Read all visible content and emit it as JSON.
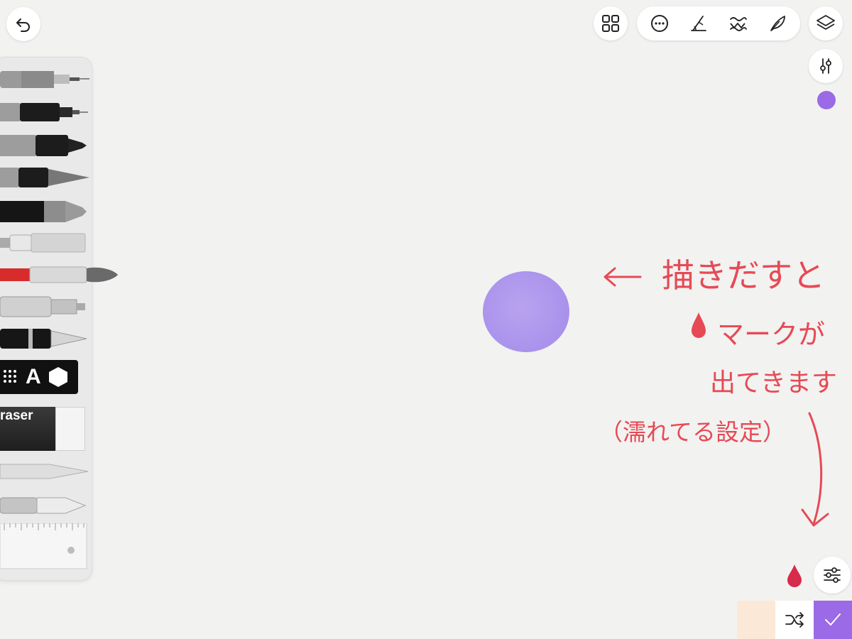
{
  "app": {
    "mode": "drawing-canvas"
  },
  "toolbar": {
    "icons": [
      "undo-icon",
      "grid-icon",
      "more-icon",
      "pen-angle-icon",
      "wave-icon",
      "feather-icon",
      "layers-icon",
      "sliders-icon"
    ]
  },
  "current_color": "#9b6ae6",
  "palette": {
    "swatch_color": "#fbe8d6",
    "confirm_color": "#9b6ae6"
  },
  "tools": {
    "stamp_letter": "A",
    "eraser_label": "raser"
  },
  "annotation": {
    "line1": "描きだすと",
    "line2": "マークが",
    "line3": "出てきます",
    "line4": "（濡れてる設定）",
    "color": "#e64a55"
  }
}
